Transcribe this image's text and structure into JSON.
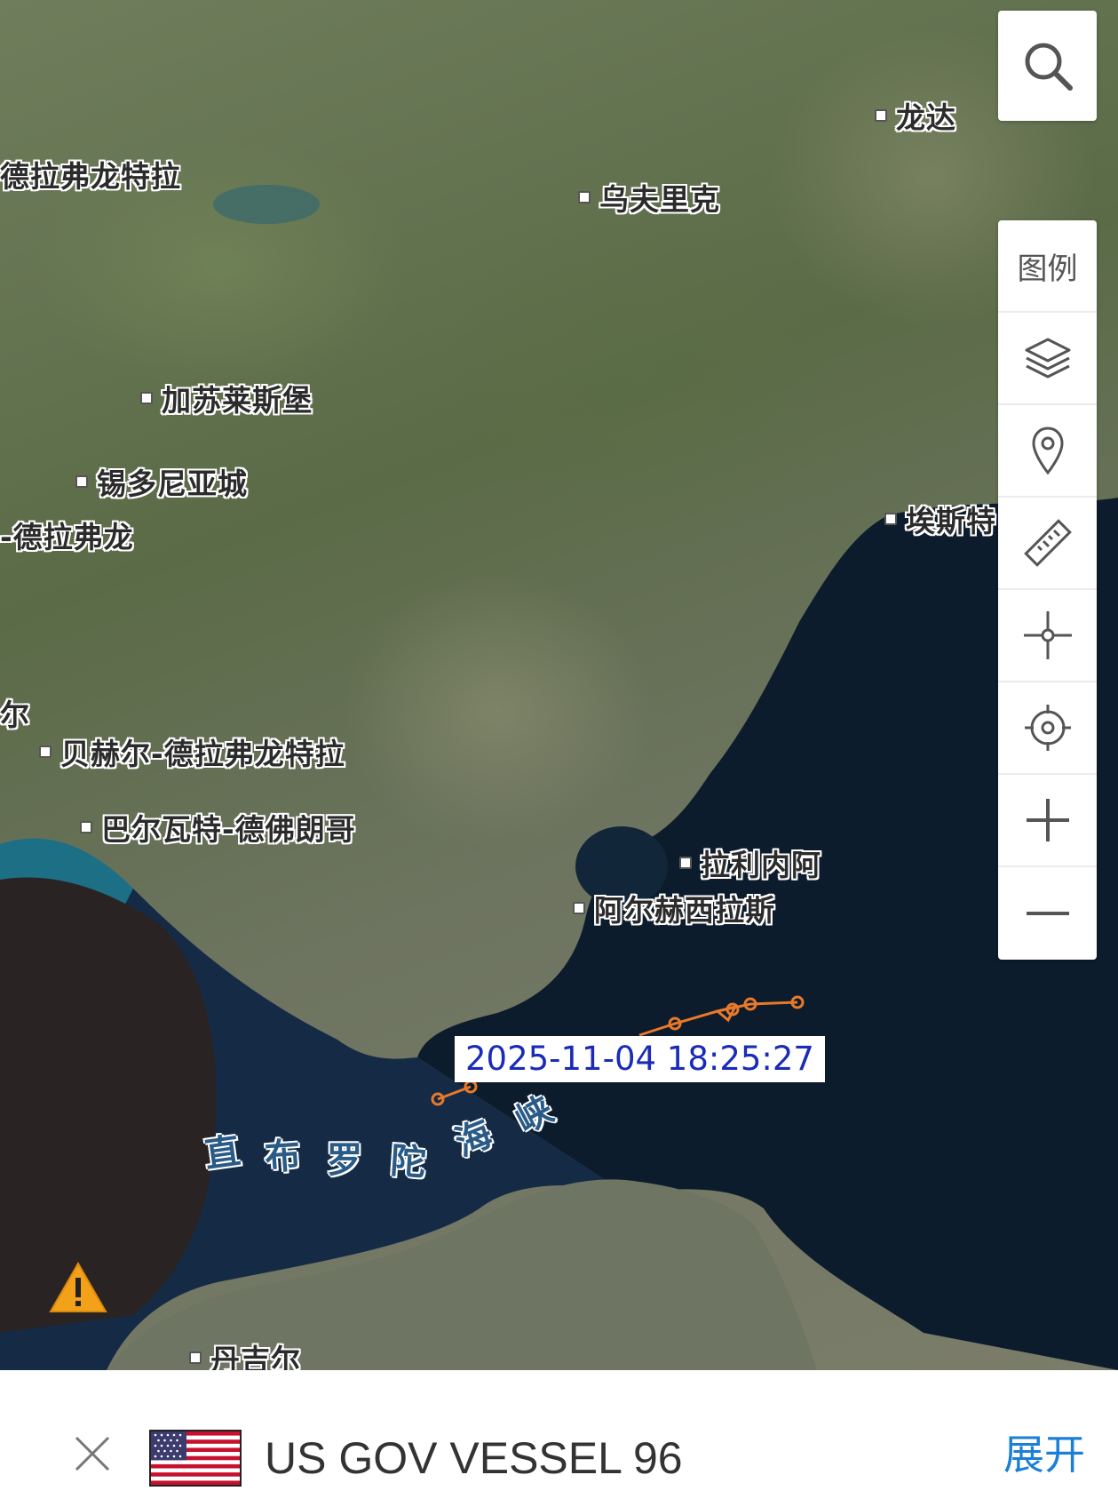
{
  "map": {
    "places": [
      {
        "name": "龙达",
        "side": "right"
      },
      {
        "name": "德拉弗龙特拉",
        "side": "none"
      },
      {
        "name": "乌夫里克",
        "side": "right"
      },
      {
        "name": "加苏莱斯堡",
        "side": "right"
      },
      {
        "name": "锡多尼亚城",
        "side": "right"
      },
      {
        "name": "-德拉弗龙",
        "side": "none"
      },
      {
        "name": "埃斯特",
        "side": "right"
      },
      {
        "name": "尔",
        "side": "none"
      },
      {
        "name": "贝赫尔-德拉弗龙特拉",
        "side": "right"
      },
      {
        "name": "巴尔瓦特-德佛朗哥",
        "side": "right"
      },
      {
        "name": "拉利内阿",
        "side": "right"
      },
      {
        "name": "阿尔赫西拉斯",
        "side": "right"
      },
      {
        "name": "丹吉尔",
        "side": "right"
      }
    ],
    "strait_label": [
      "直",
      "布",
      "罗",
      "陀",
      "海",
      "峡"
    ],
    "track_timestamp": "2025-11-04 18:25:27",
    "track_color": "#e8782a"
  },
  "controls": {
    "search_icon": "search-icon",
    "legend_label": "图例",
    "tools": [
      "layers-icon",
      "location-pin-icon",
      "ruler-icon",
      "crosshair-icon",
      "locate-target-icon",
      "zoom-in-icon",
      "zoom-out-icon"
    ]
  },
  "bottom_bar": {
    "vessel_name": "US GOV VESSEL 96",
    "flag": "us-flag-icon",
    "expand_label": "展开",
    "close_icon": "close-icon"
  }
}
